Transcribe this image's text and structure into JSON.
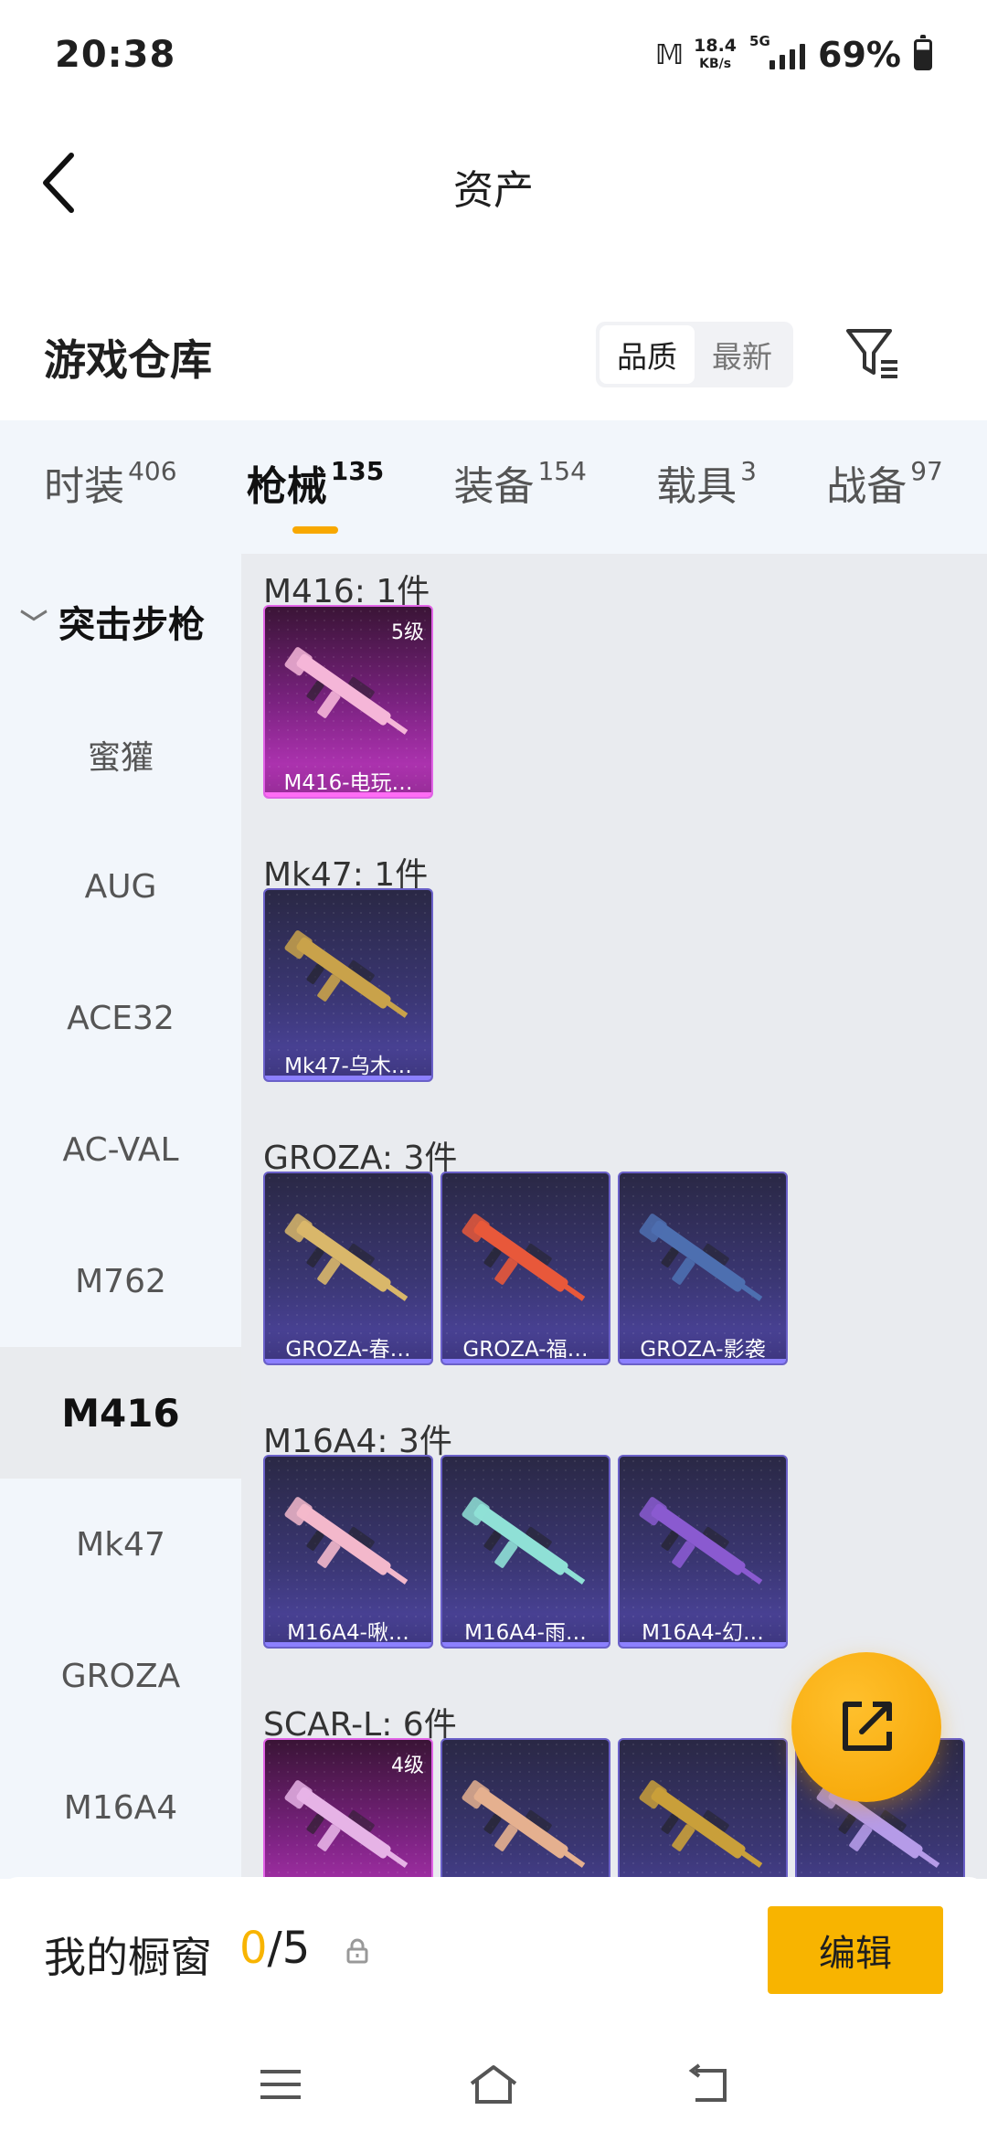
{
  "status": {
    "time": "20:38",
    "speed_value": "18.4",
    "speed_unit": "KB/s",
    "network": "5G",
    "battery": "69%"
  },
  "header": {
    "title": "资产"
  },
  "warehouse": {
    "title": "游戏仓库",
    "sort_options": [
      "品质",
      "最新"
    ],
    "sort_selected": "品质"
  },
  "tabs": [
    {
      "label": "时装",
      "count": "406"
    },
    {
      "label": "枪械",
      "count": "135",
      "active": true
    },
    {
      "label": "装备",
      "count": "154"
    },
    {
      "label": "载具",
      "count": "3"
    },
    {
      "label": "战备",
      "count": "97"
    }
  ],
  "sidebar": {
    "category": "突击步枪",
    "items": [
      "蜜獾",
      "AUG",
      "ACE32",
      "AC-VAL",
      "M762",
      "M416",
      "Mk47",
      "GROZA",
      "M16A4"
    ],
    "selected": "M416"
  },
  "groups": [
    {
      "title": "M416: 1件",
      "items": [
        {
          "name": "M416-电玩…",
          "level": "5级",
          "tier": "gold",
          "color": "#f5b6d8"
        }
      ]
    },
    {
      "title": "Mk47: 1件",
      "items": [
        {
          "name": "Mk47-乌木…",
          "level": "",
          "tier": "purple",
          "color": "#c9a24a"
        }
      ]
    },
    {
      "title": "GROZA: 3件",
      "items": [
        {
          "name": "GROZA-春…",
          "level": "",
          "tier": "purple",
          "color": "#d9b76a"
        },
        {
          "name": "GROZA-福…",
          "level": "",
          "tier": "purple",
          "color": "#e8583a"
        },
        {
          "name": "GROZA-影袭",
          "level": "",
          "tier": "purple",
          "color": "#4d6fb0"
        }
      ]
    },
    {
      "title": "M16A4: 3件",
      "items": [
        {
          "name": "M16A4-啾…",
          "level": "",
          "tier": "purple",
          "color": "#f3b8cb"
        },
        {
          "name": "M16A4-雨…",
          "level": "",
          "tier": "purple",
          "color": "#8fe0d6"
        },
        {
          "name": "M16A4-幻…",
          "level": "",
          "tier": "purple",
          "color": "#8a5ad0"
        }
      ]
    },
    {
      "title": "SCAR-L: 6件",
      "items": [
        {
          "name": "",
          "level": "4级",
          "tier": "gold",
          "color": "#e6b3e6"
        },
        {
          "name": "",
          "level": "",
          "tier": "purple",
          "color": "#e5b08f"
        },
        {
          "name": "",
          "level": "",
          "tier": "purple",
          "color": "#c99f3a"
        },
        {
          "name": "",
          "level": "",
          "tier": "purple",
          "color": "#b59be8"
        }
      ]
    }
  ],
  "showcase": {
    "title": "我的橱窗",
    "current": "0",
    "separator": "/",
    "max": "5",
    "edit_label": "编辑"
  },
  "icons": {
    "back": "back-arrow-icon",
    "filter": "filter-icon",
    "share": "share-icon",
    "lock": "lock-icon",
    "menu": "menu-icon",
    "home": "home-icon",
    "return": "return-icon"
  },
  "colors": {
    "accent": "#f8b400",
    "gold_tier": "#c53ac6",
    "purple_tier": "#5047a6"
  }
}
